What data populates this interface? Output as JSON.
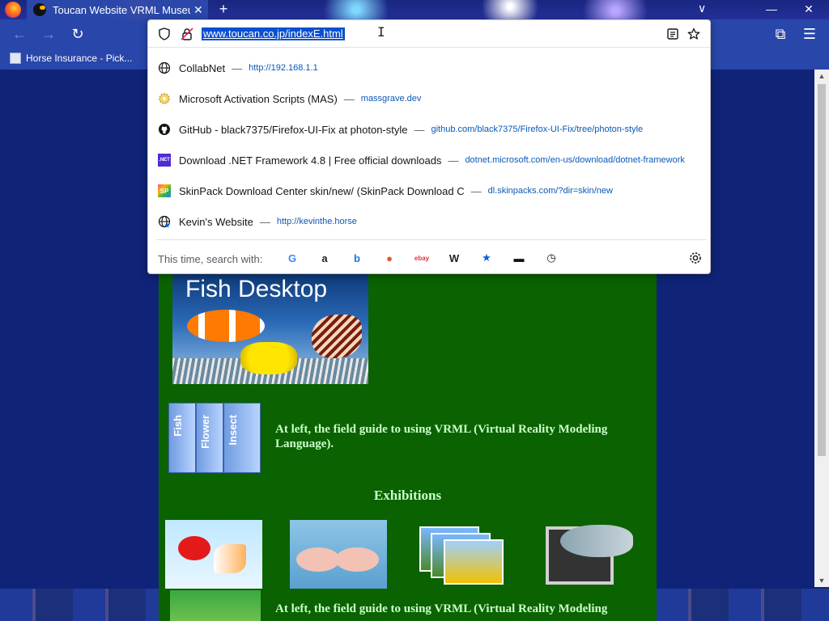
{
  "browser": {
    "tab_title": "Toucan Website VRML Museum",
    "tab_close": "✕",
    "new_tab": "+",
    "tabs_menu": "∨",
    "win_minimize": "—",
    "win_close": "✕",
    "back": "←",
    "forward": "→",
    "reload": "↻",
    "bookmark_label": "Horse Insurance - Pick...",
    "extensions": "⧉",
    "menu": "☰"
  },
  "urlbar": {
    "url": "www.toucan.co.jp/indexE.html"
  },
  "suggestions": [
    {
      "title": "CollabNet",
      "url": "http://192.168.1.1",
      "icon": "globe-icon"
    },
    {
      "title": "Microsoft Activation Scripts (MAS)",
      "url": "massgrave.dev",
      "icon": "gear-site-icon"
    },
    {
      "title": "GitHub - black7375/Firefox-UI-Fix at photon-style",
      "url": "github.com/black7375/Firefox-UI-Fix/tree/photon-style",
      "icon": "github-icon"
    },
    {
      "title": "Download .NET Framework 4.8 | Free official downloads",
      "url": "dotnet.microsoft.com/en-us/download/dotnet-framework",
      "icon": "dotnet-icon"
    },
    {
      "title": "SkinPack Download Center skin/new/ (SkinPack Download C",
      "url": "dl.skinpacks.com/?dir=skin/new",
      "icon": "skinpack-icon"
    },
    {
      "title": "Kevin's Website",
      "url": "http://kevinthe.horse",
      "icon": "bookmark-globe-icon"
    }
  ],
  "separator": "—",
  "search_with": {
    "label": "This time, search with:",
    "engines": [
      {
        "name": "google-icon",
        "glyph": "G",
        "color": "#4285f4"
      },
      {
        "name": "amazon-icon",
        "glyph": "a",
        "color": "#222222"
      },
      {
        "name": "bing-icon",
        "glyph": "b",
        "color": "#1a73e8"
      },
      {
        "name": "duckduckgo-icon",
        "glyph": "●",
        "color": "#de5833"
      },
      {
        "name": "ebay-icon",
        "glyph": "ebay",
        "color": "#e53238"
      },
      {
        "name": "wikipedia-icon",
        "glyph": "W",
        "color": "#222222"
      },
      {
        "name": "bookmarks-star-icon",
        "glyph": "★",
        "color": "#0061e0"
      },
      {
        "name": "tabs-icon",
        "glyph": "▬",
        "color": "#15141a"
      },
      {
        "name": "history-icon",
        "glyph": "◷",
        "color": "#15141a"
      }
    ]
  },
  "page": {
    "banner_title": "Fish Desktop",
    "books": [
      "Fish",
      "Flower",
      "Insect"
    ],
    "caption": "At left, the field guide to using VRML (Virtual Reality Modeling Language).",
    "exhibitions_heading": "Exhibitions",
    "bottom_caption": "At left, the field guide to using VRML (Virtual Reality Modeling"
  },
  "scroll": {
    "up": "▲",
    "down": "▼"
  }
}
